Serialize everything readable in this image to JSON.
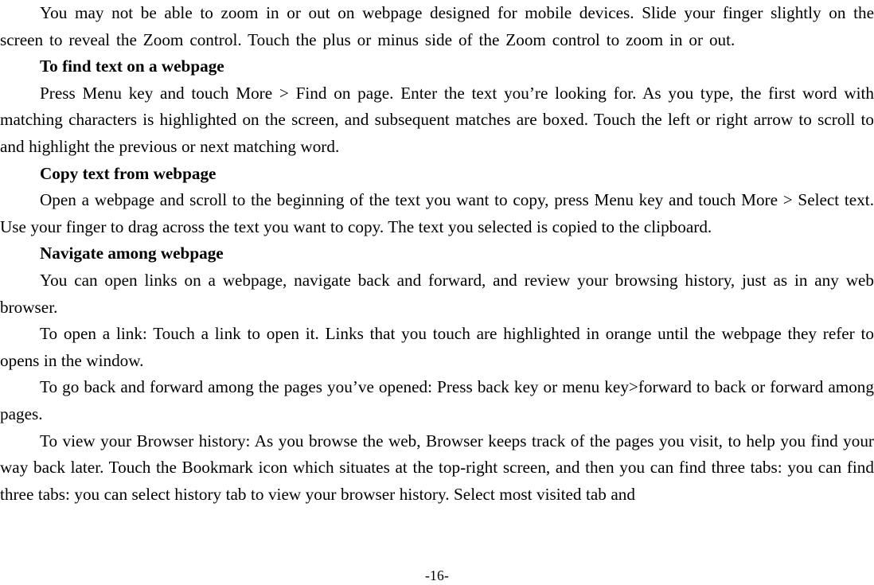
{
  "document": {
    "page_number_label": "-16-",
    "blocks": [
      {
        "kind": "paragraph",
        "style": "stretch",
        "name": "paragraph-zoom-webpage",
        "text": "You may not be able to zoom in or out on webpage designed for mobile devices. Slide your finger slightly on the screen to reveal the Zoom control. Touch the plus or minus side of the Zoom control to zoom in or out."
      },
      {
        "kind": "heading",
        "name": "heading-find-text-on-a-webpage",
        "text": "To find text on a webpage"
      },
      {
        "kind": "paragraph",
        "style": "loose",
        "name": "paragraph-find-text",
        "text": "Press Menu key and touch More > Find on page. Enter the text you’re looking for. As you type, the first word with matching characters is highlighted on the screen, and subsequent matches are boxed. Touch the left or right arrow to scroll to and highlight the previous or next matching word."
      },
      {
        "kind": "heading",
        "name": "heading-copy-text-from-webpage",
        "text": "Copy text from webpage"
      },
      {
        "kind": "paragraph",
        "style": "loose",
        "name": "paragraph-copy-text",
        "text": "Open a webpage and scroll to the beginning of the text you want to copy, press Menu key and touch More > Select text. Use your finger to drag across the text you want to copy. The text you selected is copied to the clipboard."
      },
      {
        "kind": "heading",
        "name": "heading-navigate-among-webpage",
        "text": "Navigate among webpage"
      },
      {
        "kind": "paragraph",
        "style": "loose",
        "name": "paragraph-open-links",
        "text": "You can open links on a webpage, navigate back and forward, and review your browsing history, just as in any web browser."
      },
      {
        "kind": "paragraph",
        "style": "loose",
        "name": "paragraph-open-a-link",
        "text": "To open a link: Touch a link to open it. Links that you touch are highlighted in orange until the webpage they refer to opens in the window."
      },
      {
        "kind": "paragraph",
        "style": "loose",
        "name": "paragraph-go-back-and-forward",
        "text": "To go back and forward among the pages you’ve opened: Press back key or menu key>forward to back or forward among pages."
      },
      {
        "kind": "paragraph",
        "style": "loose",
        "name": "paragraph-browser-history",
        "text": "To view your Browser history: As you browse the web, Browser keeps track of the pages you visit, to help you find your way back later. Touch the Bookmark icon which situates at the top-right screen, and then you can find three tabs: you can find three tabs: you can select history tab to view your browser history. Select most visited tab and"
      }
    ]
  }
}
